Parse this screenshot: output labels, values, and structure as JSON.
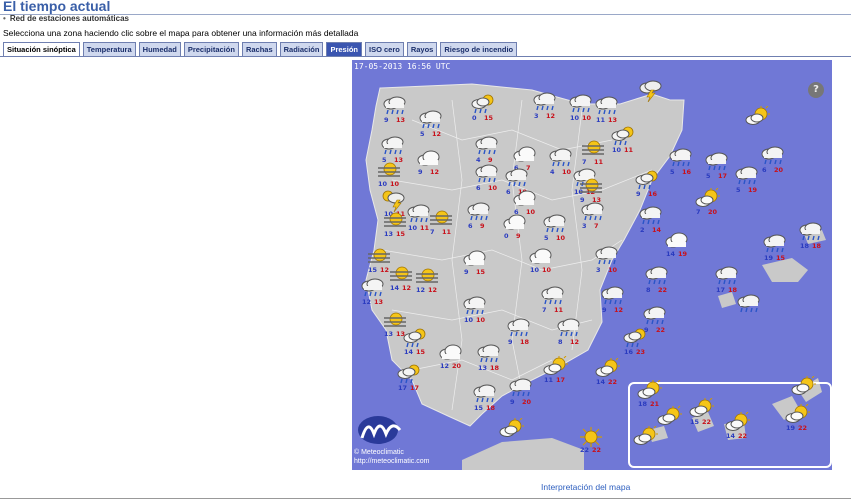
{
  "page_title": "El tiempo actual",
  "section_title": "Red de estaciones automáticas",
  "instruction": "Selecciona una zona haciendo clic sobre el mapa para obtener una información más detallada",
  "tabs": [
    {
      "label": "Situación sinóptica",
      "state": "active"
    },
    {
      "label": "Temperatura",
      "state": "normal"
    },
    {
      "label": "Humedad",
      "state": "normal"
    },
    {
      "label": "Precipitación",
      "state": "normal"
    },
    {
      "label": "Rachas",
      "state": "normal"
    },
    {
      "label": "Radiación",
      "state": "normal"
    },
    {
      "label": "Presión",
      "state": "selected"
    },
    {
      "label": "ISO cero",
      "state": "normal"
    },
    {
      "label": "Rayos",
      "state": "normal"
    },
    {
      "label": "Riesgo de incendio",
      "state": "normal"
    }
  ],
  "map": {
    "timestamp": "17-05-2013 16:56 UTC",
    "help": "?",
    "credit_name": "© Meteoclimatic",
    "credit_url": "http://meteoclimatic.com",
    "colors": {
      "sea": "#7078d6",
      "land": "#c9c9c9",
      "min_temp": "#2a3bbf",
      "max_temp": "#c8101a"
    }
  },
  "stations": [
    {
      "icon": "rain",
      "min": "9",
      "max": "13"
    },
    {
      "icon": "rain",
      "min": "5",
      "max": "12"
    },
    {
      "icon": "sun-rain",
      "min": "0",
      "max": "15"
    },
    {
      "icon": "rain",
      "min": "3",
      "max": "12"
    },
    {
      "icon": "rain",
      "min": "10",
      "max": "10"
    },
    {
      "icon": "rain",
      "min": "11",
      "max": "13"
    },
    {
      "icon": "storm",
      "min": "",
      "max": ""
    },
    {
      "icon": "rain",
      "min": "5",
      "max": "13"
    },
    {
      "icon": "rain",
      "min": "4",
      "max": "9"
    },
    {
      "icon": "cloud",
      "min": "6",
      "max": "7"
    },
    {
      "icon": "rain",
      "min": "4",
      "max": "10"
    },
    {
      "icon": "fog",
      "min": "7",
      "max": "11"
    },
    {
      "icon": "sun-rain",
      "min": "10",
      "max": "11"
    },
    {
      "icon": "sun-cloud",
      "min": "",
      "max": ""
    },
    {
      "icon": "fog",
      "min": "10",
      "max": "10"
    },
    {
      "icon": "cloud",
      "min": "9",
      "max": "12"
    },
    {
      "icon": "rain",
      "min": "10",
      "max": "12"
    },
    {
      "icon": "rain",
      "min": "6",
      "max": "10"
    },
    {
      "icon": "fog",
      "min": "9",
      "max": "13"
    },
    {
      "icon": "rain",
      "min": "5",
      "max": "16"
    },
    {
      "icon": "rain",
      "min": "5",
      "max": "17"
    },
    {
      "icon": "rain",
      "min": "6",
      "max": "20"
    },
    {
      "icon": "storm-sun",
      "min": "10",
      "max": "11"
    },
    {
      "icon": "rain",
      "min": "6",
      "max": "10"
    },
    {
      "icon": "cloud",
      "min": "6",
      "max": "10"
    },
    {
      "icon": "sun-rain",
      "min": "9",
      "max": "16"
    },
    {
      "icon": "rain",
      "min": "5",
      "max": "19"
    },
    {
      "icon": "sun-cloud",
      "min": "7",
      "max": "20"
    },
    {
      "icon": "fog",
      "min": "13",
      "max": "15"
    },
    {
      "icon": "rain",
      "min": "10",
      "max": "11"
    },
    {
      "icon": "fog",
      "min": "7",
      "max": "11"
    },
    {
      "icon": "rain",
      "min": "6",
      "max": "9"
    },
    {
      "icon": "cloud",
      "min": "0",
      "max": "9"
    },
    {
      "icon": "rain",
      "min": "5",
      "max": "10"
    },
    {
      "icon": "rain",
      "min": "3",
      "max": "7"
    },
    {
      "icon": "rain",
      "min": "2",
      "max": "14"
    },
    {
      "icon": "fog",
      "min": "15",
      "max": "12"
    },
    {
      "icon": "cloud",
      "min": "9",
      "max": "15"
    },
    {
      "icon": "cloud",
      "min": "10",
      "max": "10"
    },
    {
      "icon": "rain",
      "min": "3",
      "max": "10"
    },
    {
      "icon": "cloud",
      "min": "14",
      "max": "19"
    },
    {
      "icon": "rain",
      "min": "19",
      "max": "15"
    },
    {
      "icon": "rain",
      "min": "18",
      "max": "18"
    },
    {
      "icon": "rain",
      "min": "12",
      "max": "13"
    },
    {
      "icon": "fog",
      "min": "14",
      "max": "12"
    },
    {
      "icon": "fog",
      "min": "12",
      "max": "12"
    },
    {
      "icon": "rain",
      "min": "7",
      "max": "11"
    },
    {
      "icon": "rain",
      "min": "9",
      "max": "12"
    },
    {
      "icon": "rain",
      "min": "8",
      "max": "22"
    },
    {
      "icon": "rain",
      "min": "17",
      "max": "18"
    },
    {
      "icon": "rain",
      "min": "",
      "max": ""
    },
    {
      "icon": "fog",
      "min": "13",
      "max": "13"
    },
    {
      "icon": "rain",
      "min": "10",
      "max": "10"
    },
    {
      "icon": "rain",
      "min": "9",
      "max": "18"
    },
    {
      "icon": "rain",
      "min": "8",
      "max": "12"
    },
    {
      "icon": "rain",
      "min": "9",
      "max": "22"
    },
    {
      "icon": "sun-rain",
      "min": "14",
      "max": "15"
    },
    {
      "icon": "cloud",
      "min": "12",
      "max": "20"
    },
    {
      "icon": "rain",
      "min": "13",
      "max": "18"
    },
    {
      "icon": "sun-rain",
      "min": "16",
      "max": "23"
    },
    {
      "icon": "sun-rain",
      "min": "17",
      "max": "17"
    },
    {
      "icon": "sun-cloud",
      "min": "11",
      "max": "17"
    },
    {
      "icon": "sun-cloud",
      "min": "14",
      "max": "22"
    },
    {
      "icon": "rain",
      "min": "15",
      "max": "18"
    },
    {
      "icon": "rain",
      "min": "9",
      "max": "20"
    },
    {
      "icon": "sun-cloud",
      "min": "",
      "max": ""
    },
    {
      "icon": "sun",
      "min": "22",
      "max": "22"
    },
    {
      "icon": "sun-cloud",
      "min": "18",
      "max": "21"
    },
    {
      "icon": "sun-cloud",
      "min": "",
      "max": ""
    },
    {
      "icon": "sun-cloud",
      "min": "15",
      "max": "22"
    },
    {
      "icon": "sun-cloud",
      "min": "14",
      "max": "22"
    },
    {
      "icon": "sun-cloud",
      "min": "19",
      "max": "22"
    },
    {
      "icon": "sun-cloud",
      "min": "",
      "max": ""
    },
    {
      "icon": "sun-cloud",
      "min": "",
      "max": ""
    }
  ],
  "link_interpretation": "Interpretación del mapa"
}
